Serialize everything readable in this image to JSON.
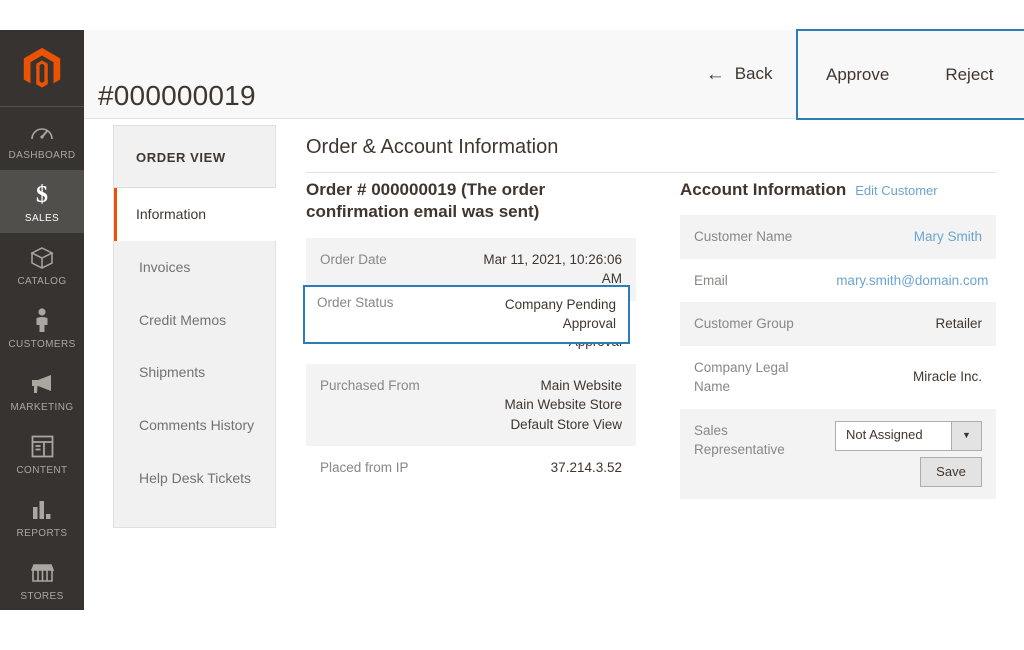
{
  "header": {
    "title": "#000000019",
    "back_label": "Back",
    "back_icon": "arrow-left-icon",
    "approve_label": "Approve",
    "reject_label": "Reject",
    "highlight_color": "#2a7eb8"
  },
  "sidebar": {
    "logo_icon": "magento-logo",
    "items": [
      {
        "label": "DASHBOARD",
        "icon": "dashboard-gauge-icon",
        "active": false
      },
      {
        "label": "SALES",
        "icon": "dollar-sign-icon",
        "active": true
      },
      {
        "label": "CATALOG",
        "icon": "box-icon",
        "active": false
      },
      {
        "label": "CUSTOMERS",
        "icon": "person-icon",
        "active": false
      },
      {
        "label": "MARKETING",
        "icon": "megaphone-icon",
        "active": false
      },
      {
        "label": "CONTENT",
        "icon": "layout-page-icon",
        "active": false
      },
      {
        "label": "REPORTS",
        "icon": "bar-chart-icon",
        "active": false
      },
      {
        "label": "STORES",
        "icon": "storefront-icon",
        "active": false
      }
    ]
  },
  "order_view": {
    "title": "ORDER VIEW",
    "items": [
      {
        "label": "Information",
        "active": true
      },
      {
        "label": "Invoices",
        "active": false
      },
      {
        "label": "Credit Memos",
        "active": false
      },
      {
        "label": "Shipments",
        "active": false
      },
      {
        "label": "Comments History",
        "active": false
      },
      {
        "label": "Help Desk Tickets",
        "active": false
      }
    ]
  },
  "main": {
    "section_heading": "Order & Account Information",
    "order_block": {
      "title": "Order # 000000019 (The order confirmation email was sent)",
      "rows": [
        {
          "label": "Order Date",
          "value": "Mar 11, 2021, 10:26:06 AM",
          "shade": true
        },
        {
          "label": "Order Status",
          "value": "Company Pending Approval",
          "shade": false,
          "highlighted": true
        },
        {
          "label": "Purchased From",
          "value": "Main Website\nMain Website Store\nDefault Store View",
          "shade": true
        },
        {
          "label": "Placed from IP",
          "value": "37.214.3.52",
          "shade": false
        }
      ]
    },
    "account_block": {
      "title": "Account Information",
      "edit_link": "Edit Customer",
      "rows": [
        {
          "label": "Customer Name",
          "value": "Mary Smith",
          "shade": true,
          "link": true
        },
        {
          "label": "Email",
          "value": "mary.smith@domain.com",
          "shade": false,
          "link": true
        },
        {
          "label": "Customer Group",
          "value": "Retailer",
          "shade": true,
          "link": false
        },
        {
          "label": "Company Legal Name",
          "value": "Miracle Inc.",
          "shade": false,
          "link": false
        }
      ],
      "sales_rep": {
        "label": "Sales Representative",
        "selected": "Not Assigned",
        "dropdown_icon": "chevron-down-icon",
        "save_label": "Save"
      }
    }
  },
  "colors": {
    "accent_orange": "#eb5202",
    "link_blue": "#6ba4cf",
    "focus_blue": "#2a7eb8",
    "nav_bg": "#373330"
  }
}
